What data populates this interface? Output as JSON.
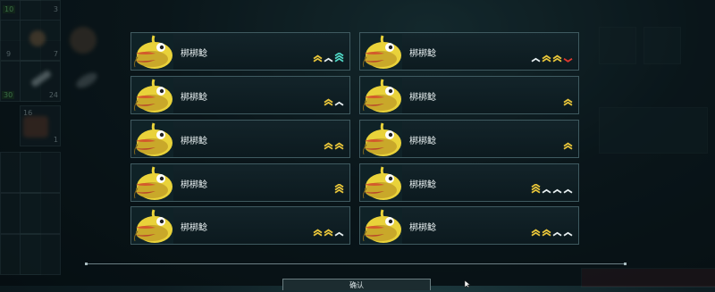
{
  "background": {
    "inventory_numbers": [
      "10",
      "3",
      "9",
      "7",
      "30",
      "24",
      "16",
      "1"
    ]
  },
  "fish_list": [
    {
      "name": "梆梆鲶",
      "ranks": [
        "gold-double",
        "white-chevron",
        "cyan-triple"
      ]
    },
    {
      "name": "梆梆鲶",
      "ranks": [
        "white-chevron",
        "gold-double",
        "gold-double",
        "red-chevron-down"
      ]
    },
    {
      "name": "梆梆鲶",
      "ranks": [
        "gold-double",
        "white-chevron"
      ]
    },
    {
      "name": "梆梆鲶",
      "ranks": [
        "gold-double"
      ]
    },
    {
      "name": "梆梆鲶",
      "ranks": [
        "gold-double",
        "gold-double"
      ]
    },
    {
      "name": "梆梆鲶",
      "ranks": [
        "gold-double"
      ]
    },
    {
      "name": "梆梆鲶",
      "ranks": [
        "gold-triple"
      ]
    },
    {
      "name": "梆梆鲶",
      "ranks": [
        "gold-triple",
        "white-chevron",
        "white-chevron",
        "white-chevron"
      ]
    },
    {
      "name": "梆梆鲶",
      "ranks": [
        "gold-double",
        "gold-double",
        "white-chevron"
      ]
    },
    {
      "name": "梆梆鲶",
      "ranks": [
        "gold-double",
        "gold-double",
        "white-chevron",
        "white-chevron"
      ]
    }
  ],
  "confirm_button": {
    "label": "确认"
  },
  "colors": {
    "gold": "#e8c53a",
    "white": "#e6eef0",
    "cyan": "#4fd6c4",
    "red": "#e0392f",
    "fish": "#e9d23a"
  }
}
